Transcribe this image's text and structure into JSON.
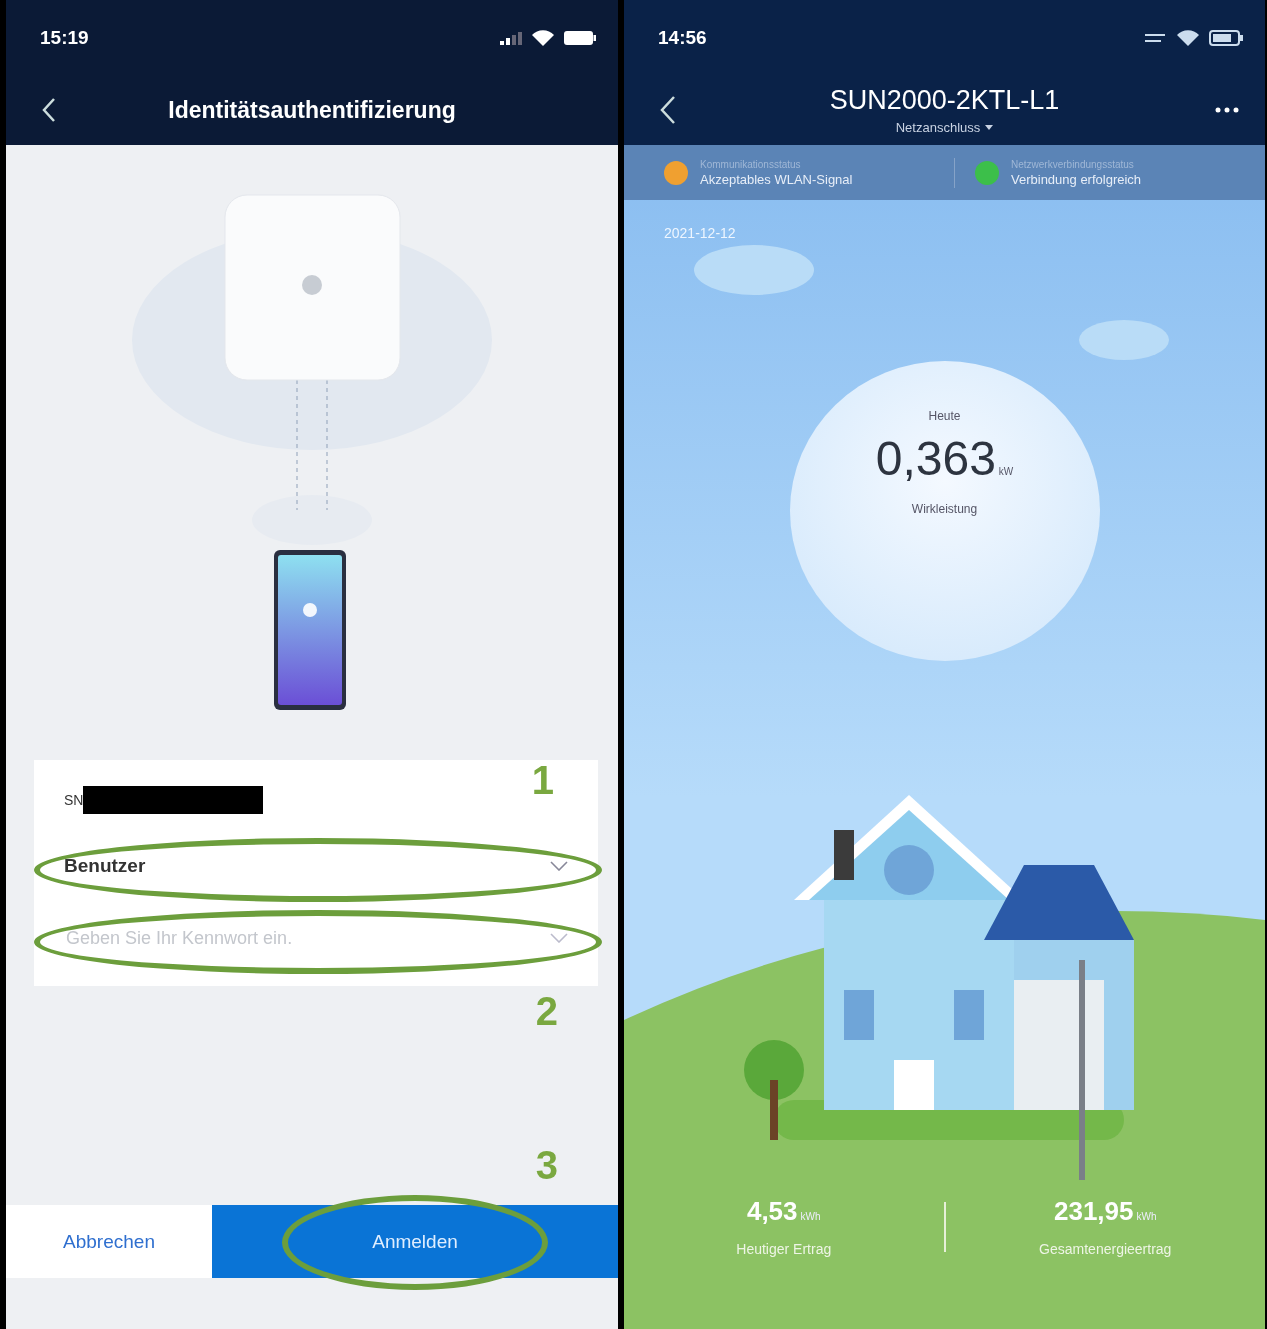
{
  "login_screen": {
    "status_bar": {
      "time": "15:19"
    },
    "title": "Identitätsauthentifizierung",
    "fields": [
      {
        "kind": "serial",
        "label": "SN",
        "redacted": true
      },
      {
        "kind": "dropdown",
        "value": "Benutzer",
        "annotation": "1"
      },
      {
        "kind": "password",
        "placeholder": "Geben Sie Ihr Kennwort ein.",
        "annotation": "2"
      }
    ],
    "buttons": [
      {
        "label": "Abbrechen",
        "primary": false
      },
      {
        "label": "Anmelden",
        "primary": true,
        "annotation": "3"
      }
    ]
  },
  "inverter_screen": {
    "status_bar": {
      "time": "14:56"
    },
    "title": "SUN2000-2KTL-L1",
    "subtitle": "Netzanschluss",
    "status_items": [
      {
        "label": "Kommunikationsstatus",
        "value": "Akzeptables WLAN-Signal",
        "color": "#f0a030"
      },
      {
        "label": "Netzwerkverbindungsstatus",
        "value": "Verbindung erfolgreich",
        "color": "#3cbf4a"
      }
    ],
    "date": "2021-12-12",
    "power": {
      "caption": "Heute",
      "value": "0,363",
      "unit": "kW",
      "label": "Wirkleistung"
    },
    "stats": [
      {
        "value": "4,53",
        "unit": "kWh",
        "label": "Heutiger Ertrag"
      },
      {
        "value": "231,95",
        "unit": "kWh",
        "label": "Gesamtenergieertrag"
      }
    ]
  }
}
